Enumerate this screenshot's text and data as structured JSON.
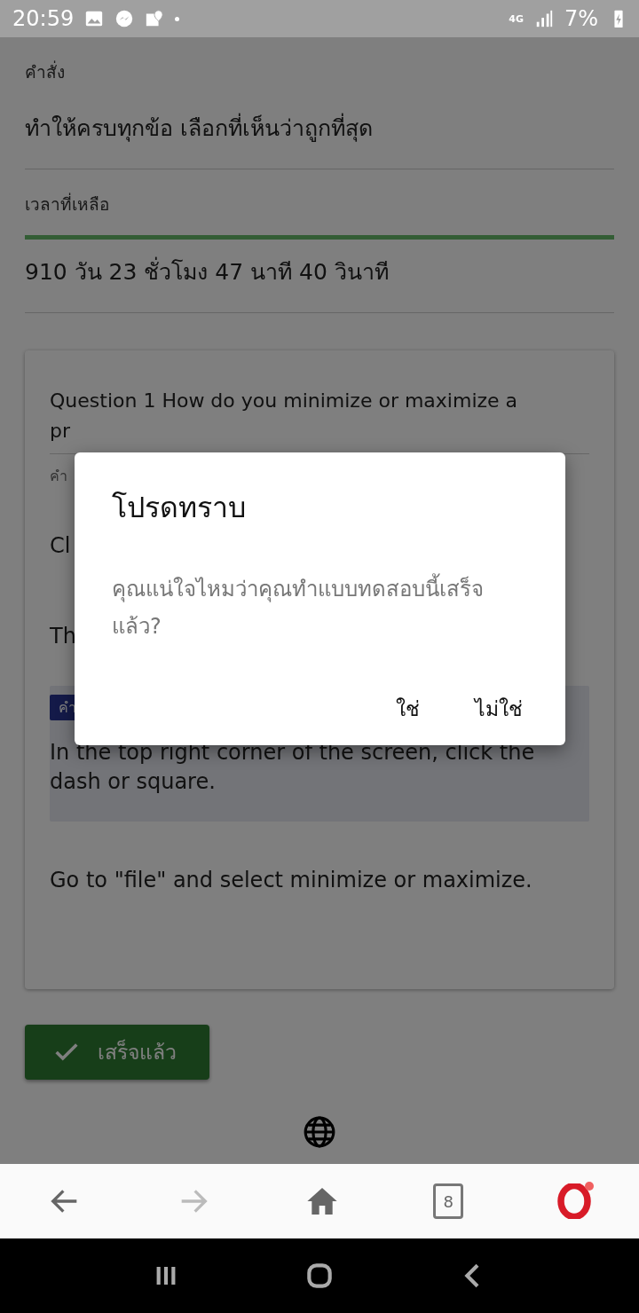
{
  "status_bar": {
    "time": "20:59",
    "network": "4G",
    "battery": "7%"
  },
  "instruction": {
    "label": "คำสั่ง",
    "text": "ทำให้ครบทุกข้อ เลือกที่เห็นว่าถูกที่สุด"
  },
  "time_left": {
    "label": "เวลาที่เหลือ",
    "level": 1,
    "text": "910 วัน 23 ชั่วโมง 47 นาที 40 วินาที"
  },
  "question": {
    "lines": [
      "Question 1 How do you minimize or maximize a",
      "pr"
    ],
    "answer_label": "คำ",
    "options": [
      {
        "text": "Cl",
        "selected": false
      },
      {
        "text": "Th",
        "selected": false
      },
      {
        "text": "In the top right corner of the screen, click the dash or square.",
        "selected": true,
        "badge": "คำ"
      },
      {
        "text": "Go to \"file\" and select minimize or maximize.",
        "selected": false
      }
    ]
  },
  "done_button": {
    "label": "เสร็จแล้ว"
  },
  "dialog": {
    "title": "โปรดทราบ",
    "message": "คุณแน่ใจไหมว่าคุณทำแบบทดสอบนี้เสร็จแล้ว?",
    "buttons": [
      "ใช่",
      "ไม่ใช่"
    ]
  },
  "browser_toolbar": {
    "tab_count": "8"
  }
}
